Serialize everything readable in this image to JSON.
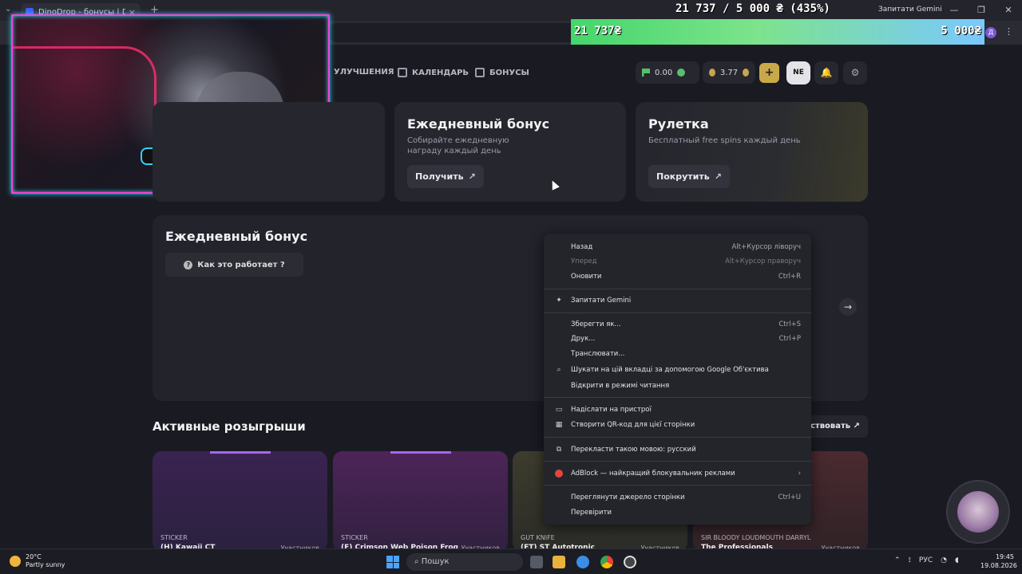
{
  "browser": {
    "tab_title": "DinoDrop - бонусы | DinoDrop",
    "gemini_button": "Запитати Gemini",
    "profile_letter": "Д"
  },
  "overlay": {
    "goal_text": "21 737 / 5 000 ₴ (435%)",
    "progress_current": "21 737₴",
    "progress_goal": "5 000₴",
    "progress_percent": 435
  },
  "nav": {
    "upgrades": "УЛУЧШЕНИЯ",
    "calendar": "КАЛЕНДАРЬ",
    "bonuses": "БОНУСЫ",
    "balance_green": "0.00",
    "balance_coin": "3.77",
    "plus": "+",
    "ne": "NE"
  },
  "cards": {
    "daily": {
      "title": "Ежедневный бонус",
      "desc": "Собирайте ежедневную награду каждый день",
      "button": "Получить"
    },
    "roulette": {
      "title": "Рулетка",
      "desc": "Бесплатный free spins каждый день",
      "button": "Покрутить"
    }
  },
  "panel": {
    "title": "Ежедневный бонус",
    "how_button": "Как это работает ?"
  },
  "giveaways": {
    "title": "Активные розыгрыши",
    "participate": "ствовать",
    "items": [
      {
        "type": "STICKER",
        "name": "(H) Kawaii CT",
        "participants": "Участников"
      },
      {
        "type": "STICKER",
        "name": "(F) Crimson Web Poison Frog",
        "participants": "Участников"
      },
      {
        "type": "GUT KNIFE",
        "name": "(FT) ST Autotronic",
        "participants": "Участников"
      },
      {
        "type": "SIR BLOODY LOUDMOUTH DARRYL",
        "name": "The Professionals",
        "participants": "Участников"
      }
    ]
  },
  "context_menu": {
    "items": [
      {
        "label": "Назад",
        "shortcut": "Alt+Курсор ліворуч"
      },
      {
        "label": "Уперед",
        "shortcut": "Alt+Курсор праворуч",
        "disabled": true
      },
      {
        "label": "Оновити",
        "shortcut": "Ctrl+R"
      },
      {
        "label": "Запитати Gemini",
        "shortcut": ""
      },
      {
        "label": "Зберегти як...",
        "shortcut": "Ctrl+S"
      },
      {
        "label": "Друк...",
        "shortcut": "Ctrl+P"
      },
      {
        "label": "Транслювати...",
        "shortcut": ""
      },
      {
        "label": "Шукати на цій вкладці за допомогою Google Об'єктива",
        "shortcut": ""
      },
      {
        "label": "Відкрити в режимі читання",
        "shortcut": ""
      },
      {
        "label": "Надіслати на пристрої",
        "shortcut": ""
      },
      {
        "label": "Створити QR-код для цієї сторінки",
        "shortcut": ""
      },
      {
        "label": "Перекласти такою мовою: русский",
        "shortcut": ""
      },
      {
        "label": "AdBlock — найкращий блокувальник реклами",
        "shortcut": "›"
      },
      {
        "label": "Переглянути джерело сторінки",
        "shortcut": "Ctrl+U"
      },
      {
        "label": "Перевірити",
        "shortcut": ""
      }
    ]
  },
  "taskbar": {
    "temp": "20°C",
    "weather": "Partly sunny",
    "search": "Пошук",
    "lang": "РУС",
    "time": "19:45",
    "date": "19.08.2026"
  }
}
